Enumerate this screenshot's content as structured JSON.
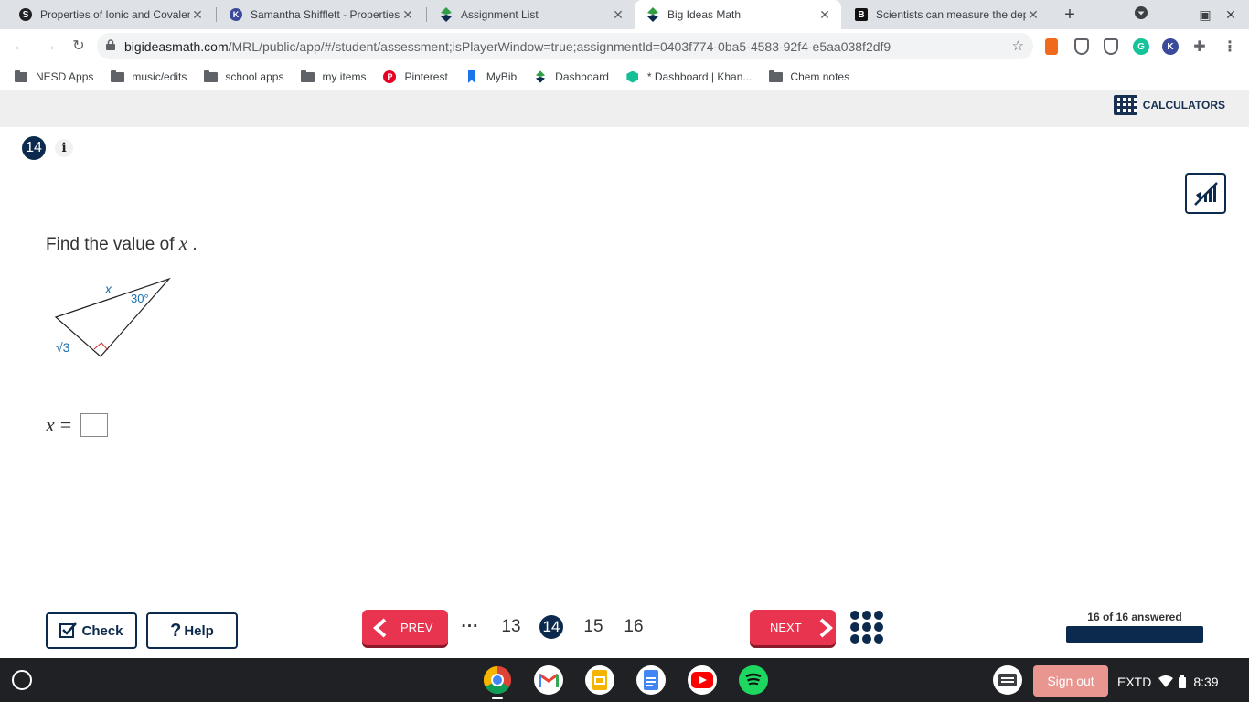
{
  "browser": {
    "tabs": [
      {
        "title": "Properties of Ionic and Covalent",
        "icon": "s-favicon"
      },
      {
        "title": "Samantha Shifflett - Properties",
        "icon": "k-favicon"
      },
      {
        "title": "Assignment List",
        "icon": "big-ideas-favicon"
      },
      {
        "title": "Big Ideas Math",
        "icon": "big-ideas-favicon"
      },
      {
        "title": "Scientists can measure the depth",
        "icon": "b-favicon"
      }
    ],
    "url_domain": "bigideasmath.com",
    "url_path": "/MRL/public/app/#/student/assessment;isPlayerWindow=true;assignmentId=0403f774-0ba5-4583-92f4-e5aa038f2df9",
    "bookmarks": [
      {
        "label": "NESD Apps",
        "icon": "apps-icon"
      },
      {
        "label": "music/edits",
        "icon": "folder-icon"
      },
      {
        "label": "school apps",
        "icon": "folder-icon"
      },
      {
        "label": "my items",
        "icon": "folder-icon"
      },
      {
        "label": "Pinterest",
        "icon": "pinterest-icon"
      },
      {
        "label": "MyBib",
        "icon": "mybib-icon"
      },
      {
        "label": "Dashboard",
        "icon": "big-ideas-icon"
      },
      {
        "label": "* Dashboard | Khan...",
        "icon": "khan-icon"
      },
      {
        "label": "Chem notes",
        "icon": "folder-icon"
      }
    ]
  },
  "header": {
    "calculators_label": "CALCULATORS"
  },
  "question": {
    "number": "14",
    "info_label": "i",
    "prompt_prefix": "Find the value of ",
    "prompt_var": "x",
    "prompt_suffix": " .",
    "figure": {
      "side_label": "x",
      "angle_label": "30°",
      "leg_label": "√3"
    },
    "answer_var": "x",
    "answer_equals": "="
  },
  "footer": {
    "check_label": "Check",
    "help_label": "Help",
    "prev_label": "PREV",
    "next_label": "NEXT",
    "ellipsis": "···",
    "pages": [
      "13",
      "14",
      "15",
      "16"
    ],
    "current_page": "14",
    "answered_text": "16 of 16 answered",
    "progress_fraction": 1.0
  },
  "shelf": {
    "apps": [
      "chrome-icon",
      "gmail-icon",
      "slides-icon",
      "docs-icon",
      "youtube-icon",
      "spotify-icon"
    ],
    "signout_label": "Sign out",
    "tray_label": "EXTD",
    "time": "8:39"
  },
  "colors": {
    "navy": "#0c2a4d",
    "red": "#e8344e",
    "figure_blue": "#1a6fb0"
  }
}
